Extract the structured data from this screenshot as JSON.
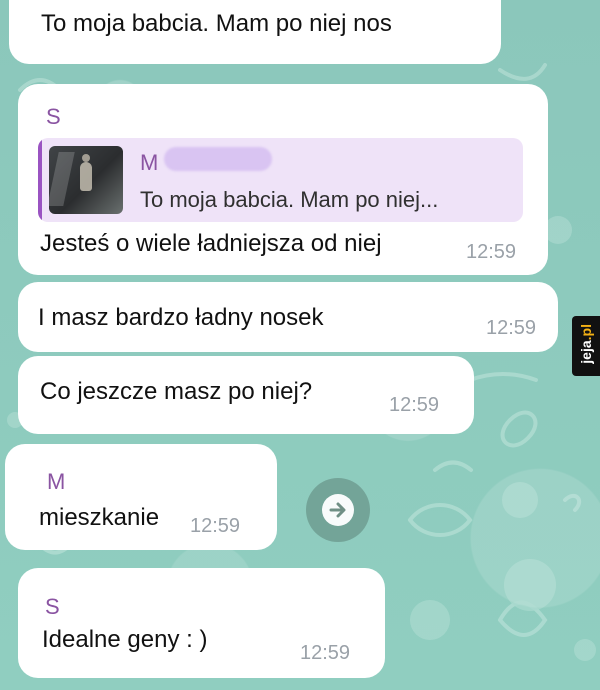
{
  "watermark": {
    "main": "jeja",
    "accent": ".pl"
  },
  "messages": {
    "top": {
      "text": "To moja babcia. Mam po niej nos"
    },
    "reply": {
      "sender": "S",
      "quote_author": "M",
      "quote_text": "To moja babcia. Mam po niej...",
      "text": "Jesteś o wiele ładniejsza od niej",
      "time": "12:59"
    },
    "nose": {
      "text": "I masz bardzo ładny nosek",
      "time": "12:59"
    },
    "question": {
      "text": "Co jeszcze masz po niej?",
      "time": "12:59"
    },
    "apartment": {
      "sender": "M",
      "text": "mieszkanie",
      "time": "12:59"
    },
    "genes": {
      "sender": "S",
      "text": "Idealne geny : )",
      "time": "12:59"
    }
  },
  "icons": {
    "forward": "forward-arrow-icon",
    "thumbnail": "photo-thumbnail"
  }
}
